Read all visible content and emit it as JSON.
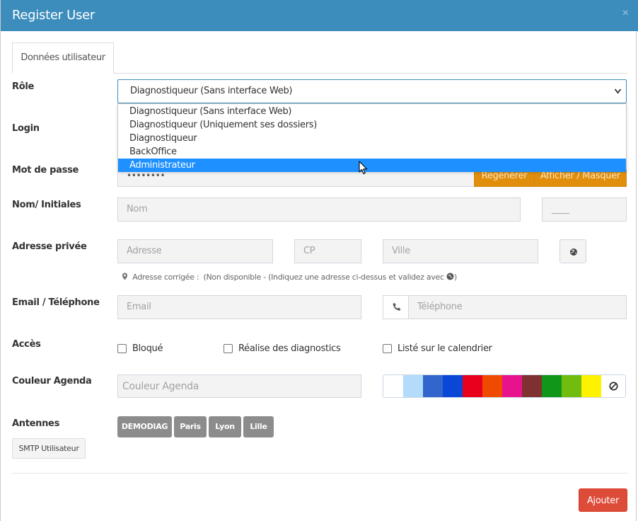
{
  "modal": {
    "title": "Register User",
    "close_glyph": "×"
  },
  "tabs": [
    {
      "label": "Données utilisateur"
    }
  ],
  "labels": {
    "role": "Rôle",
    "login": "Login",
    "password": "Mot de passe",
    "name": "Nom/ Initiales",
    "address": "Adresse privée",
    "email_phone": "Email / Téléphone",
    "access": "Accès",
    "color": "Couleur Agenda",
    "antennas": "Antennes"
  },
  "role_select": {
    "value": "Diagnostiqueur (Sans interface Web)",
    "options": [
      "Diagnostiqueur (Sans interface Web)",
      "Diagnostiqueur (Uniquement ses dossiers)",
      "Diagnostiqueur",
      "BackOffice",
      "Administrateur"
    ],
    "highlighted": "Administrateur"
  },
  "password": {
    "value": "••••••••",
    "regen_label": "Regénérer",
    "toggle_label": "Afficher / Masquer"
  },
  "name": {
    "nom_placeholder": "Nom",
    "initials_placeholder": "____"
  },
  "address": {
    "adresse_placeholder": "Adresse",
    "cp_placeholder": "CP",
    "ville_placeholder": "Ville",
    "note_prefix": "Adresse corrigée :",
    "note_text": "(Non disponible - (Indiquez une adresse ci-dessus et validez avec",
    "note_suffix": ")"
  },
  "contact": {
    "email_placeholder": "Email",
    "phone_placeholder": "Téléphone"
  },
  "access": {
    "blocked": "Bloqué",
    "diagnostics": "Réalise des diagnostics",
    "calendar": "Listé sur le calendrier"
  },
  "color": {
    "placeholder": "Couleur Agenda",
    "swatches": [
      "#ffffff",
      "#b3dcfb",
      "#3366cc",
      "#0a47d6",
      "#e8001c",
      "#f04a00",
      "#e8138c",
      "#7f3030",
      "#109618",
      "#70bd10",
      "#fff200"
    ]
  },
  "antennas": [
    "DEMODIAG",
    "Paris",
    "Lyon",
    "Lille"
  ],
  "smtp_label": "SMTP Utilisateur",
  "submit_label": "Ajouter"
}
